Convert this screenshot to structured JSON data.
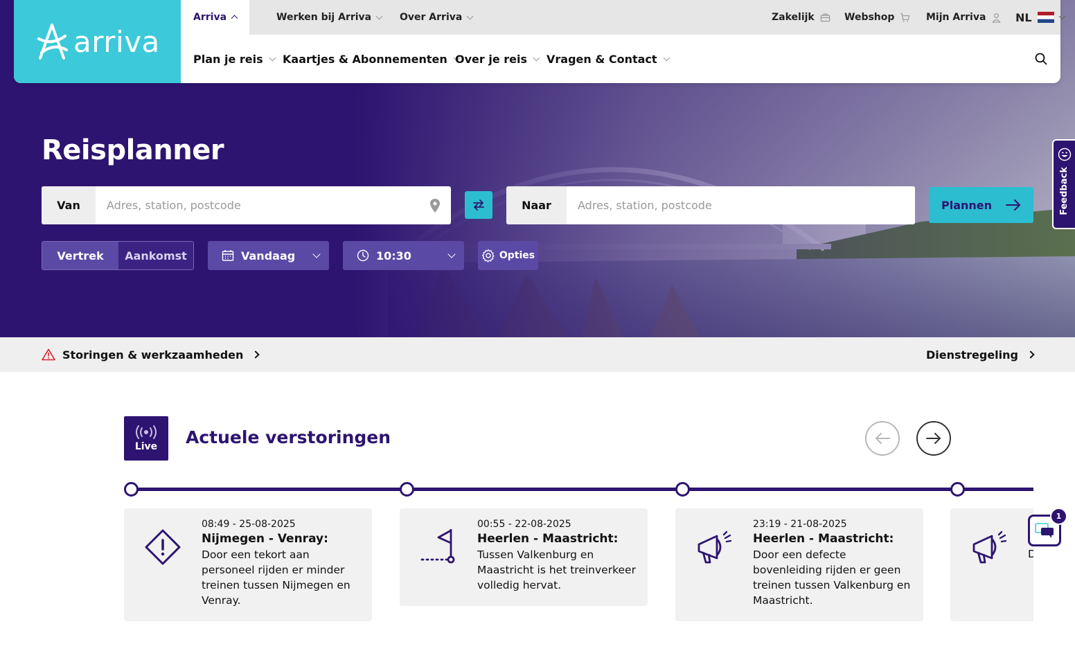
{
  "brand": {
    "logo_text": "arriva",
    "accent": "#3cc9d9",
    "primary": "#2d1470"
  },
  "topbar": {
    "items": [
      {
        "label": "Arriva",
        "active": true
      },
      {
        "label": "Werken bij Arriva"
      },
      {
        "label": "Over Arriva"
      }
    ],
    "right": {
      "zakelijk": "Zakelijk",
      "webshop": "Webshop",
      "mijn": "Mijn Arriva",
      "lang": "NL"
    }
  },
  "mainnav": {
    "items": [
      "Plan je reis",
      "Kaartjes & Abonnementen",
      "Over je reis",
      "Vragen & Contact"
    ]
  },
  "planner": {
    "title": "Reisplanner",
    "from_label": "Van",
    "from_placeholder": "Adres, station, postcode",
    "to_label": "Naar",
    "to_placeholder": "Adres, station, postcode",
    "submit": "Plannen",
    "depart": "Vertrek",
    "arrive": "Aankomst",
    "date": "Vandaag",
    "time": "10:30",
    "options": "Opties"
  },
  "feedback": {
    "label": "Feedback"
  },
  "notices": {
    "left": "Storingen & werkzaamheden",
    "right": "Dienstregeling"
  },
  "disruptions": {
    "live_label": "Live",
    "title": "Actuele verstoringen",
    "cards": [
      {
        "time": "08:49 - 25-08-2025",
        "title": "Nijmegen - Venray:",
        "text": "Door een tekort aan personeel rijden er minder treinen tussen Nijmegen en Venray.",
        "icon": "warning-diamond-icon"
      },
      {
        "time": "00:55 - 22-08-2025",
        "title": "Heerlen - Maastricht:",
        "text": "Tussen Valkenburg en Maastricht is het treinverkeer volledig hervat.",
        "icon": "finish-flag-icon"
      },
      {
        "time": "23:19 - 21-08-2025",
        "title": "Heerlen - Maastricht:",
        "text": "Door een defecte bovenleiding rijden er geen treinen tussen Valkenburg en Maastricht.",
        "icon": "megaphone-icon"
      },
      {
        "time": "",
        "title": "",
        "text": "D b n V",
        "icon": "megaphone-icon"
      }
    ]
  },
  "chat": {
    "badge": "1"
  }
}
